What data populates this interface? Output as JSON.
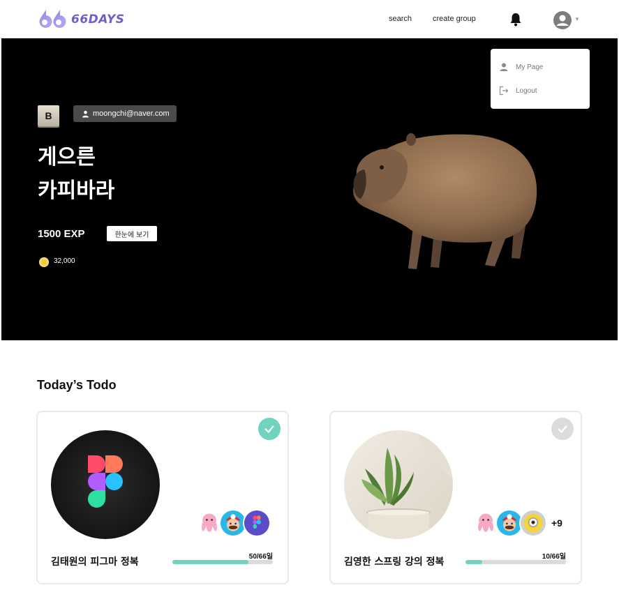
{
  "header": {
    "logo_text": "66DAYS",
    "nav": {
      "search": "search",
      "create_group": "create group"
    }
  },
  "profile_menu": {
    "items": [
      {
        "label": "My Page",
        "icon": "user-icon"
      },
      {
        "label": "Logout",
        "icon": "logout-icon"
      }
    ]
  },
  "hero": {
    "grade": "B",
    "email": "moongchi@naver.com",
    "nickname_line1": "게으른",
    "nickname_line2": "카피바라",
    "exp": "1500 EXP",
    "summary_button": "한눈에 보기",
    "coins": "32,000",
    "character_image": "capybara"
  },
  "todo": {
    "title": "Today’s Todo",
    "cards": [
      {
        "title": "김태원의 피그마 정복",
        "thumbnail": "figma-logo",
        "completed": true,
        "progress_label": "50/66일",
        "progress_fraction": 0.758,
        "members": [
          "pink-octopus-avatar",
          "mario-avatar",
          "figma-avatar"
        ],
        "extra_members": ""
      },
      {
        "title": "김영한 스프링 강의 정복",
        "thumbnail": "plant-photo",
        "completed": false,
        "progress_label": "10/66일",
        "progress_fraction": 0.17,
        "members": [
          "pink-octopus-avatar",
          "mario-avatar",
          "minion-avatar"
        ],
        "extra_members": "+9"
      }
    ]
  },
  "colors": {
    "brand": "#6f5fc9",
    "accent": "#6fd3be",
    "check_pending": "#dcdcdc"
  }
}
